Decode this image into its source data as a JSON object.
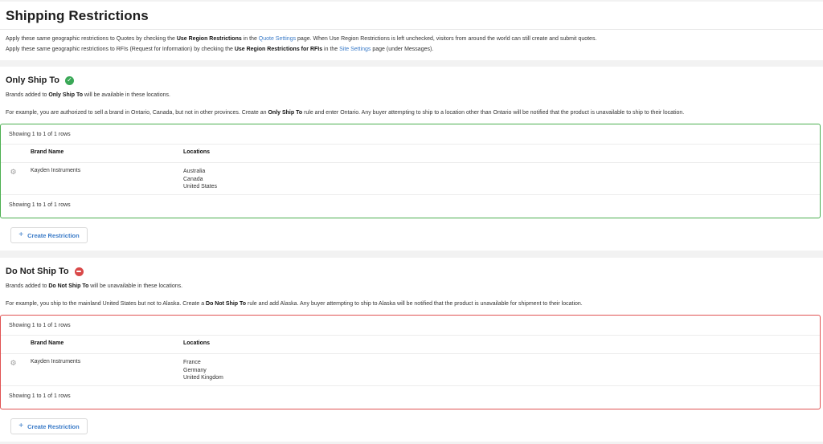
{
  "page": {
    "title": "Shipping Restrictions",
    "intro": [
      {
        "before": "Apply these same geographic restrictions to Quotes by checking the ",
        "bold": "Use Region Restrictions",
        "mid": " in the ",
        "link": "Quote Settings",
        "after": " page. When Use Region Restrictions is left unchecked, visitors from around the world can still create and submit quotes."
      },
      {
        "before": "Apply these same geographic restrictions to RFIs (Request for Information) by checking the ",
        "bold": "Use Region Restrictions for RFIs",
        "mid": " in the ",
        "link": "Site Settings",
        "after": " page (under Messages)."
      }
    ]
  },
  "sections": [
    {
      "title": "Only Ship To",
      "badge": "check",
      "border_color": "#4caf50",
      "desc_before": "Brands added to ",
      "desc_bold": "Only Ship To",
      "desc_after": " will be available in these locations.",
      "example_before": "For example, you are authorized to sell a brand in Ontario, Canada, but not in other provinces. Create an ",
      "example_bold": "Only Ship To",
      "example_after": " rule and enter Ontario. Any buyer attempting to ship to a location other than Ontario will be notified that the product is unavailable to ship to their location.",
      "rows_info": "Showing 1 to 1 of 1 rows",
      "columns": [
        "Brand Name",
        "Locations"
      ],
      "rows": [
        {
          "brand": "Kayden Instruments",
          "locations": [
            "Australia",
            "Canada",
            "United States"
          ]
        }
      ],
      "button": "Create Restriction"
    },
    {
      "title": "Do Not Ship To",
      "badge": "no-entry",
      "border_color": "#e05252",
      "desc_before": "Brands added to ",
      "desc_bold": "Do Not Ship To",
      "desc_after": " will be unavailable in these locations.",
      "example_before": "For example, you ship to the mainland United States but not to Alaska. Create a ",
      "example_bold": "Do Not Ship To",
      "example_after": " rule and add Alaska. Any buyer attempting to ship to Alaska will be notified that the product is unavailable for shipment to their location.",
      "rows_info": "Showing 1 to 1 of 1 rows",
      "columns": [
        "Brand Name",
        "Locations"
      ],
      "rows": [
        {
          "brand": "Kayden Instruments",
          "locations": [
            "France",
            "Germany",
            "United Kingdom"
          ]
        }
      ],
      "button": "Create Restriction"
    }
  ],
  "icons": {
    "row_action": "gear-icon",
    "add": "plus-icon"
  }
}
